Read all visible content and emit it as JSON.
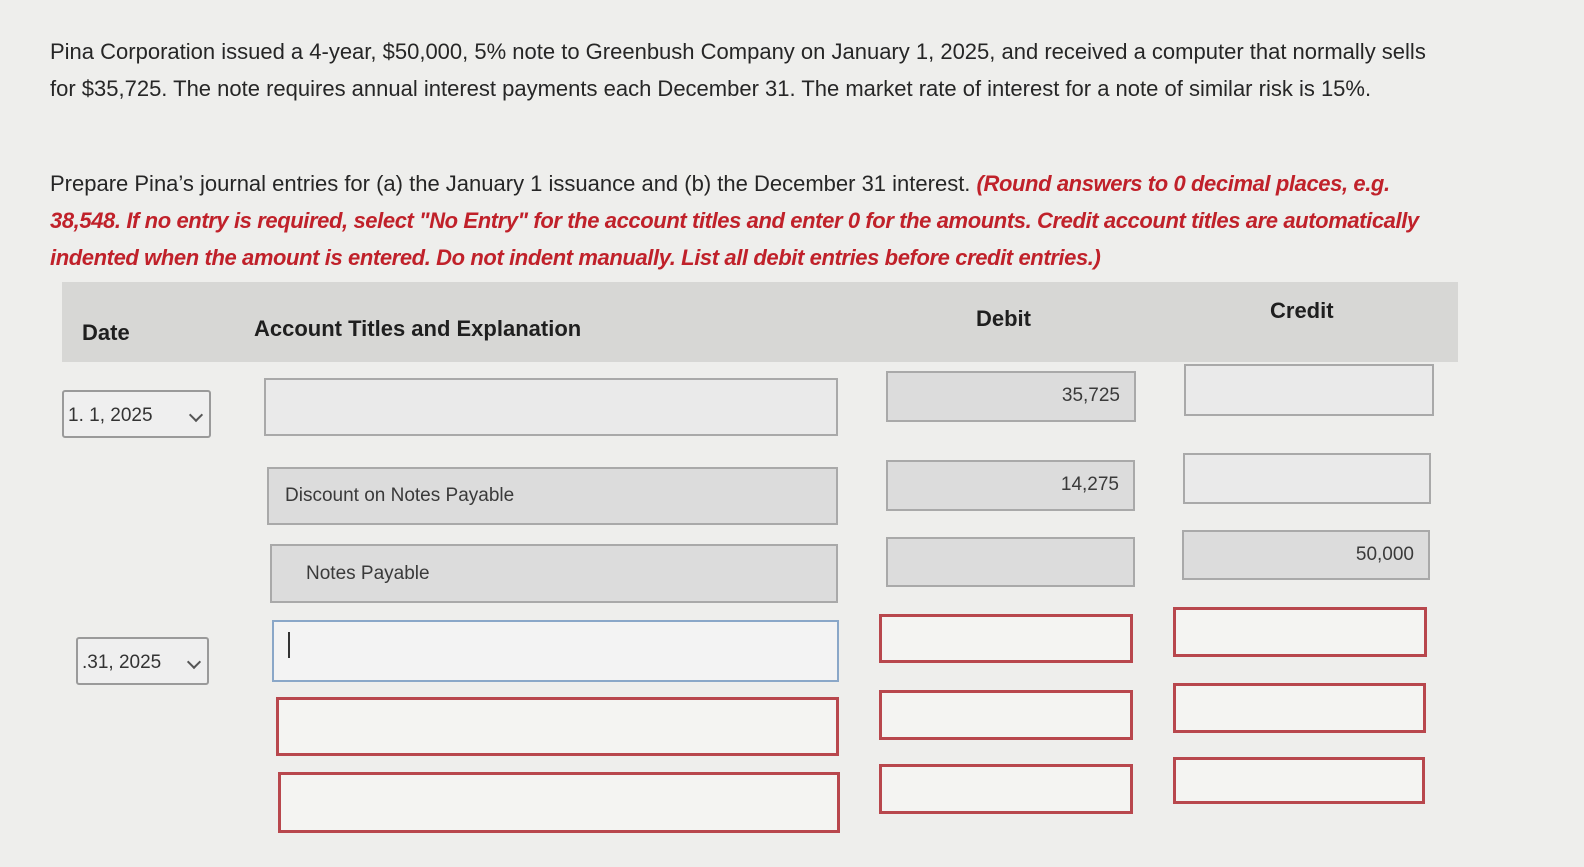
{
  "problem": {
    "intro": "Pina Corporation issued a 4-year, $50,000, 5% note to Greenbush Company on January 1, 2025, and received a computer that normally sells for $35,725. The note requires annual interest payments each December 31. The market rate of interest for a note of similar risk is 15%.",
    "prompt": "Prepare Pina’s journal entries for (a) the January 1 issuance and (b) the December 31 interest.",
    "instructions": "(Round answers to 0 decimal places, e.g. 38,548. If no entry is required, select \"No Entry\" for the account titles and enter 0 for the amounts. Credit account titles are automatically indented when the amount is entered. Do not indent manually. List all debit entries before credit entries.)"
  },
  "table": {
    "headers": {
      "date": "Date",
      "account": "Account Titles and Explanation",
      "debit": "Debit",
      "credit": "Credit"
    },
    "entries": [
      {
        "date": "1. 1, 2025",
        "rows": [
          {
            "account": "",
            "debit": "35,725",
            "credit": ""
          },
          {
            "account": "Discount on Notes Payable",
            "debit": "14,275",
            "credit": ""
          },
          {
            "account": "Notes Payable",
            "debit": "",
            "credit": "50,000"
          }
        ]
      },
      {
        "date": ".31, 2025",
        "rows": [
          {
            "account": "",
            "debit": "",
            "credit": ""
          },
          {
            "account": "",
            "debit": "",
            "credit": ""
          },
          {
            "account": "",
            "debit": "",
            "credit": ""
          }
        ]
      }
    ]
  }
}
